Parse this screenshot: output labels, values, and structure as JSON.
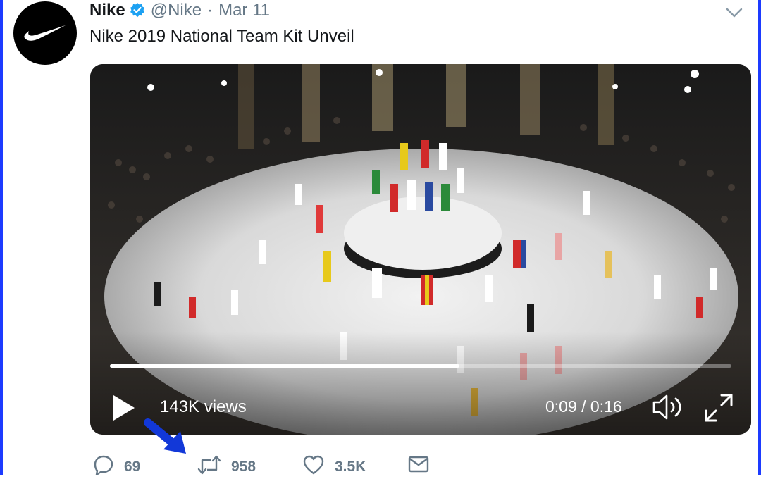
{
  "tweet": {
    "author_name": "Nike",
    "handle": "@Nike",
    "separator": "·",
    "date": "Mar 11",
    "text": "Nike 2019 National Team Kit Unveil",
    "verified": true
  },
  "video": {
    "views": "143K views",
    "time": "0:09 / 0:16",
    "progress_fraction": 0.5625
  },
  "actions": {
    "replies": "69",
    "retweets": "958",
    "likes": "3.5K"
  },
  "icons": {
    "avatar": "nike-swoosh-icon",
    "verified": "verified-badge-icon",
    "menu": "chevron-down-icon",
    "play": "play-icon",
    "volume": "volume-icon",
    "fullscreen": "fullscreen-icon",
    "reply": "reply-icon",
    "retweet": "retweet-icon",
    "like": "heart-icon",
    "dm": "envelope-icon",
    "annotation": "blue-arrow-icon"
  },
  "colors": {
    "frame_border": "#1d3bff",
    "verified": "#1da1f2",
    "secondary_text": "#657786",
    "annotation_arrow": "#1238d8"
  }
}
